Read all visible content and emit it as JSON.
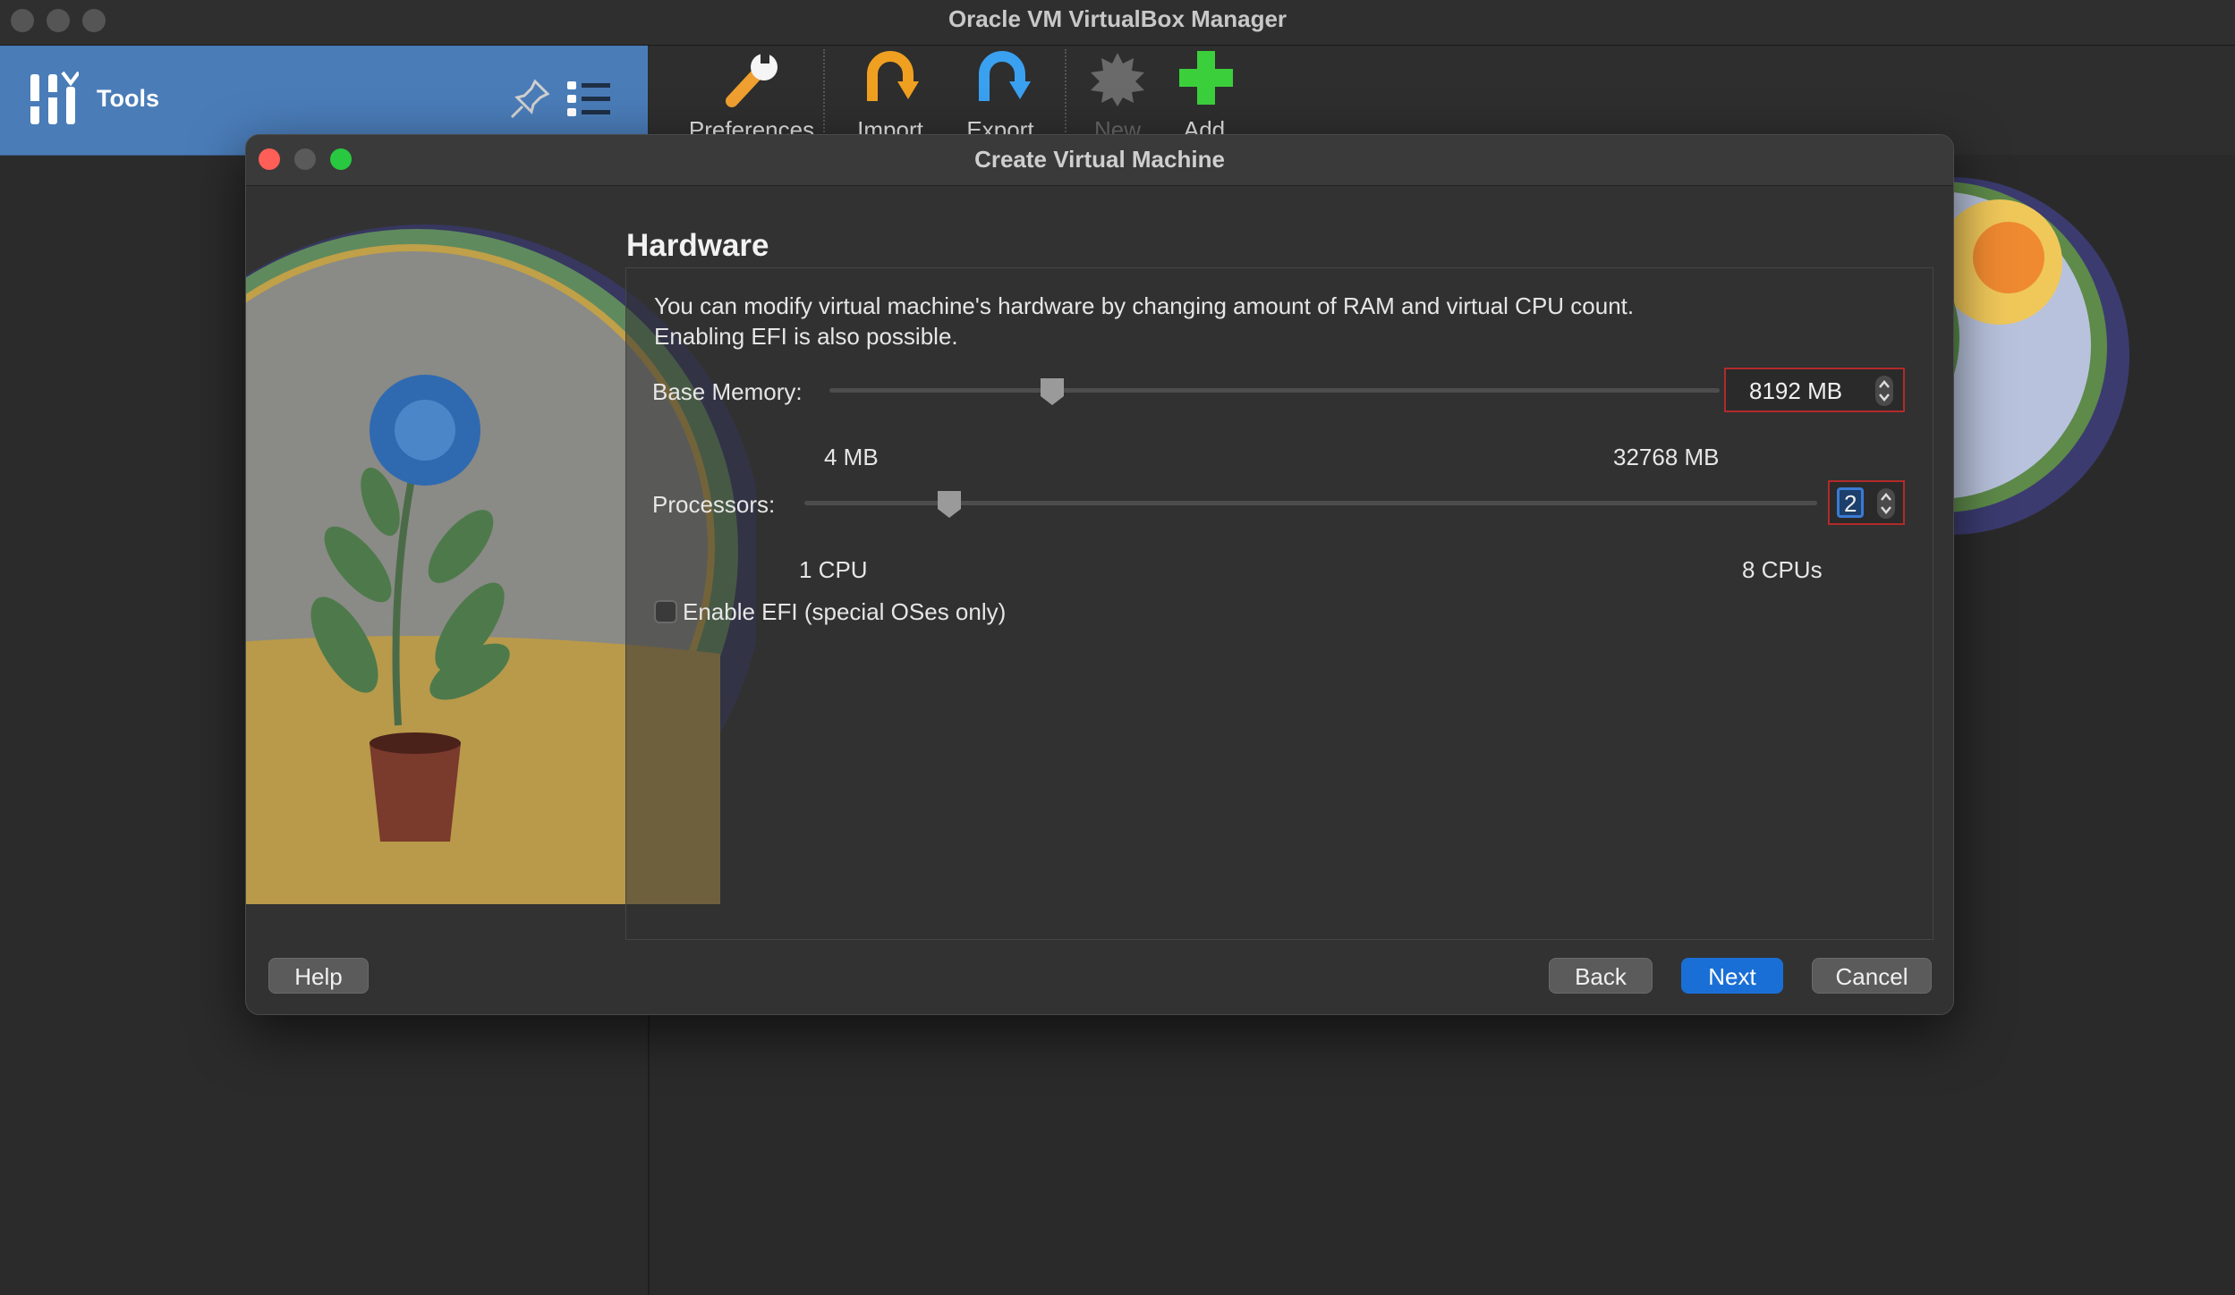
{
  "window": {
    "title": "Oracle VM VirtualBox Manager"
  },
  "tools_panel": {
    "label": "Tools"
  },
  "toolbar": {
    "items": [
      {
        "label": "Preferences",
        "icon": "preferences-wrench-icon",
        "enabled": true
      },
      {
        "label": "Import",
        "icon": "import-arrow-icon",
        "enabled": true
      },
      {
        "label": "Export",
        "icon": "export-arrow-icon",
        "enabled": true
      },
      {
        "label": "New",
        "icon": "new-gear-icon",
        "enabled": false
      },
      {
        "label": "Add",
        "icon": "add-plus-icon",
        "enabled": true
      }
    ]
  },
  "dialog": {
    "title": "Create Virtual Machine",
    "section_title": "Hardware",
    "description_line1": "You can modify virtual machine's hardware by changing amount of RAM and virtual CPU count.",
    "description_line2": "Enabling EFI is also possible.",
    "memory": {
      "label": "Base Memory:",
      "value": "8192 MB",
      "min_label": "4 MB",
      "max_label": "32768 MB",
      "level": 0.25
    },
    "processors": {
      "label": "Processors:",
      "value": "2",
      "min_label": "1 CPU",
      "max_label": "8 CPUs",
      "level": 0.143
    },
    "efi": {
      "label": "Enable EFI (special OSes only)",
      "checked": false
    },
    "buttons": {
      "help": "Help",
      "back": "Back",
      "next": "Next",
      "cancel": "Cancel"
    }
  },
  "colors": {
    "tools_panel": "#4a7cb8",
    "primary_button": "#1a6fd6",
    "focus_border": "#b22a2a",
    "close_dot": "#ff5f57",
    "minimize_dot": "#5a5a5a",
    "zoom_dot": "#28c840"
  }
}
